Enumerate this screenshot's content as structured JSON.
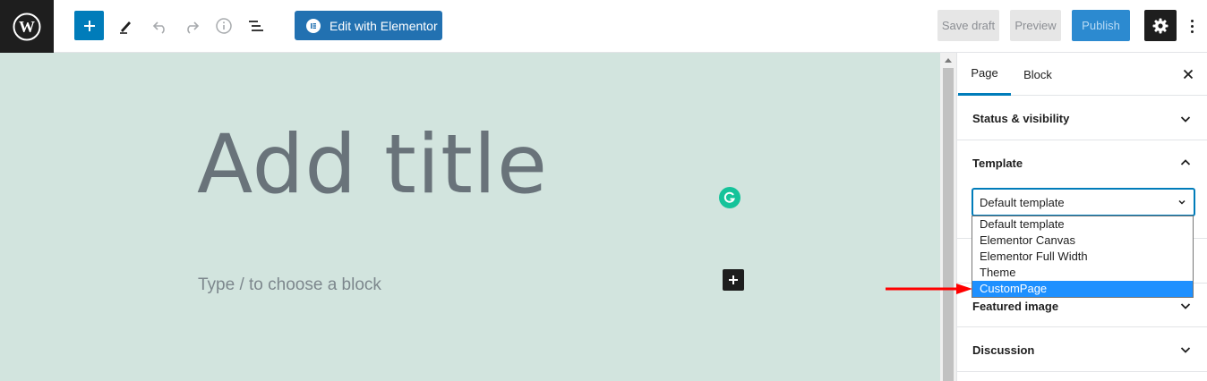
{
  "toolbar": {
    "elementor_label": "Edit with Elementor",
    "save_draft_label": "Save draft",
    "preview_label": "Preview",
    "publish_label": "Publish"
  },
  "editor": {
    "title_placeholder": "Add title",
    "block_placeholder": "Type / to choose a block"
  },
  "sidebar": {
    "tabs": [
      {
        "label": "Page",
        "active": true
      },
      {
        "label": "Block",
        "active": false
      }
    ],
    "panels": {
      "status_visibility": "Status & visibility",
      "template": "Template",
      "featured_image": "Featured image",
      "discussion": "Discussion"
    },
    "template_select": {
      "selected": "Default template",
      "options": [
        "Default template",
        "Elementor Canvas",
        "Elementor Full Width",
        "Theme",
        "CustomPage"
      ],
      "highlighted": "CustomPage"
    }
  },
  "colors": {
    "accent": "#007cba",
    "elementor": "#2271b1",
    "canvas_bg": "#d2e4de",
    "highlight": "#1e90ff",
    "arrow": "#ff0000"
  }
}
